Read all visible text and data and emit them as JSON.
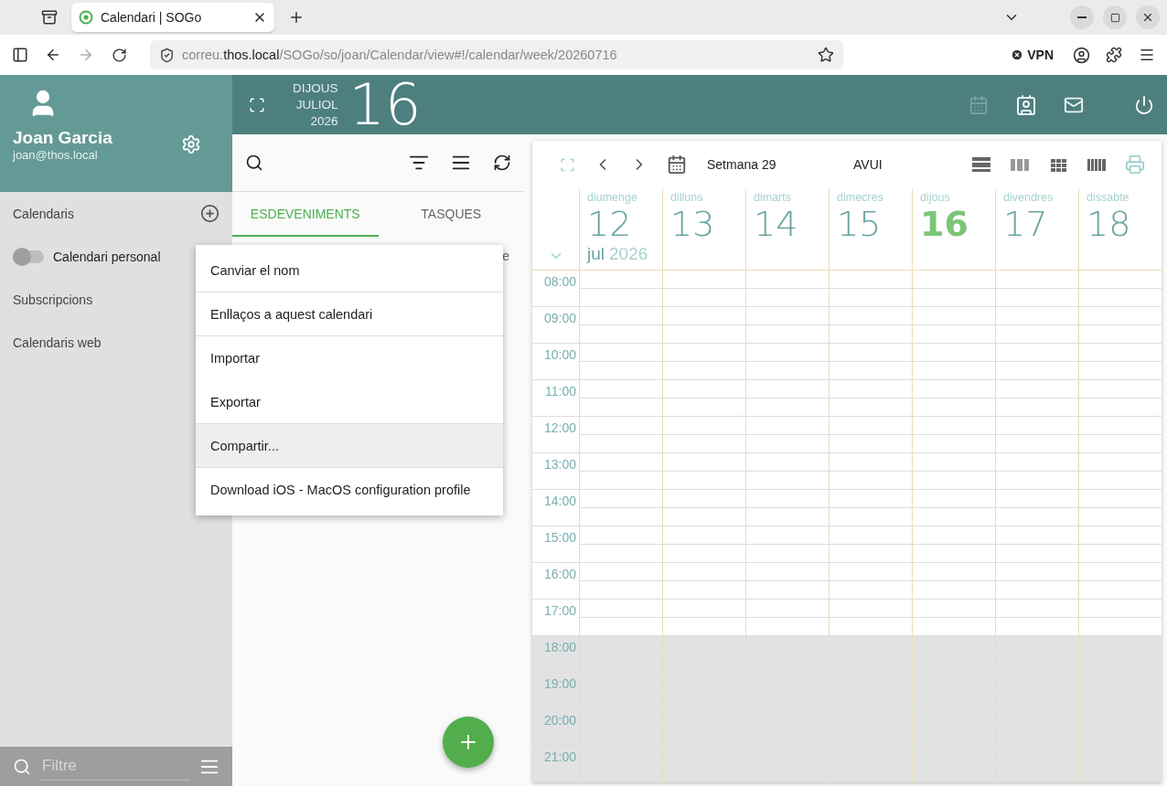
{
  "browser": {
    "tabs": [
      {
        "title": "Calendari | SOGo",
        "selected": true
      }
    ],
    "url": {
      "prefix": "correu.",
      "host": "thos.local",
      "path": "/SOGo/so/joan/Calendar/view#!/calendar/week/20260716"
    },
    "vpn": "VPN"
  },
  "user": {
    "name": "Joan Garcia",
    "email": "joan@thos.local"
  },
  "sidebar": {
    "sections": [
      {
        "kind": "header",
        "label": "Calendaris"
      },
      {
        "kind": "calendar",
        "label": "Calendari personal",
        "on": false
      },
      {
        "kind": "section",
        "label": "Subscripcions"
      },
      {
        "kind": "section",
        "label": "Calendaris web"
      }
    ],
    "filter": {
      "placeholder": "Filtre"
    }
  },
  "date_banner": {
    "weekday": "DIJOUS",
    "month": "JULIOL",
    "year": "2026",
    "day": "16"
  },
  "apps": [
    {
      "kind": "calendar",
      "selected": true
    },
    {
      "kind": "contacts",
      "selected": false
    },
    {
      "kind": "mail",
      "selected": false
    }
  ],
  "list": {
    "tabs": [
      {
        "label": "ESDEVENIMENTS",
        "selected": true
      },
      {
        "label": "TASQUES",
        "selected": false
      }
    ],
    "partial_text": "e"
  },
  "context_menu": [
    {
      "label": "Canviar el nom",
      "highlighted": false,
      "divider_after": true
    },
    {
      "label": "Enllaços a aquest calendari",
      "highlighted": false,
      "divider_after": true
    },
    {
      "label": "Importar",
      "highlighted": false,
      "divider_after": false
    },
    {
      "label": "Exportar",
      "highlighted": false,
      "divider_after": true
    },
    {
      "label": "Compartir...",
      "highlighted": true,
      "divider_after": true
    },
    {
      "label": "Download iOS - MacOS configuration profile",
      "highlighted": false,
      "divider_after": false
    }
  ],
  "calendar": {
    "week_label": "Setmana 29",
    "today_button": "AVUI",
    "month": "jul",
    "year": "2026",
    "days": [
      {
        "name": "diumenge",
        "number": "12",
        "today": false
      },
      {
        "name": "dilluns",
        "number": "13",
        "today": false
      },
      {
        "name": "dimarts",
        "number": "14",
        "today": false
      },
      {
        "name": "dimecres",
        "number": "15",
        "today": false
      },
      {
        "name": "dijous",
        "number": "16",
        "today": true
      },
      {
        "name": "divendres",
        "number": "17",
        "today": false
      },
      {
        "name": "dissabte",
        "number": "18",
        "today": false
      }
    ],
    "hours": [
      {
        "label": "08:00",
        "off_hours": false
      },
      {
        "label": "09:00",
        "off_hours": false
      },
      {
        "label": "10:00",
        "off_hours": false
      },
      {
        "label": "11:00",
        "off_hours": false
      },
      {
        "label": "12:00",
        "off_hours": false
      },
      {
        "label": "13:00",
        "off_hours": false
      },
      {
        "label": "14:00",
        "off_hours": false
      },
      {
        "label": "15:00",
        "off_hours": false
      },
      {
        "label": "16:00",
        "off_hours": false
      },
      {
        "label": "17:00",
        "off_hours": false
      },
      {
        "label": "18:00",
        "off_hours": true
      },
      {
        "label": "19:00",
        "off_hours": true
      },
      {
        "label": "20:00",
        "off_hours": true
      },
      {
        "label": "21:00",
        "off_hours": true
      }
    ]
  }
}
